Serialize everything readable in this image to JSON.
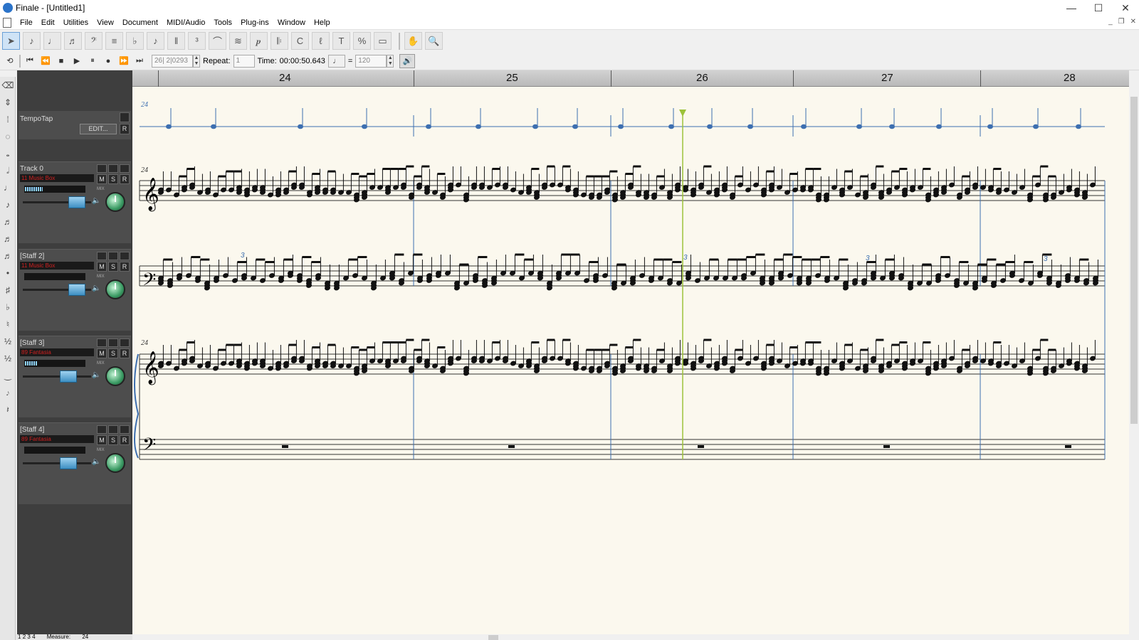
{
  "window": {
    "title": "Finale - [Untitled1]"
  },
  "menu": [
    "File",
    "Edit",
    "Utilities",
    "View",
    "Document",
    "MIDI/Audio",
    "Tools",
    "Plug-ins",
    "Window",
    "Help"
  ],
  "window_controls": {
    "minimize": "—",
    "maximize": "☐",
    "close": "✕"
  },
  "playback": {
    "counter": "26| 2|0293",
    "repeat_label": "Repeat:",
    "repeat_value": "1",
    "time_label": "Time:",
    "time_value": "00:00:50.643",
    "equals": "=",
    "tempo": "120"
  },
  "ruler": {
    "measures": [
      "24",
      "25",
      "26",
      "27",
      "28"
    ]
  },
  "mixer": {
    "tempotap": {
      "name": "TempoTap",
      "edit_label": "EDIT...",
      "r_label": "R"
    },
    "tracks": [
      {
        "name": "Track 0",
        "instrument": "11 Music Box",
        "mix_label": "MIX",
        "meter": 0.3
      },
      {
        "name": "[Staff 2]",
        "instrument": "11 Music Box",
        "mix_label": "MIX",
        "meter": 0
      },
      {
        "name": "[Staff 3]",
        "instrument": "89 Fantasia",
        "mix_label": "MIX",
        "meter": 0.2
      },
      {
        "name": "[Staff 4]",
        "instrument": "89 Fantasia",
        "mix_label": "MIX",
        "meter": 0
      }
    ],
    "buttons": {
      "m": "M",
      "s": "S",
      "r": "R"
    }
  },
  "score": {
    "measure_number": "24",
    "tuplet": "3"
  },
  "status": {
    "measure_label": "Measure:",
    "measure_value": "24",
    "pages": [
      "1",
      "2",
      "3",
      "4"
    ]
  },
  "colors": {
    "accent": "#2b73c9",
    "playhead": "#9cc23a",
    "paper": "#fbf8ee"
  }
}
